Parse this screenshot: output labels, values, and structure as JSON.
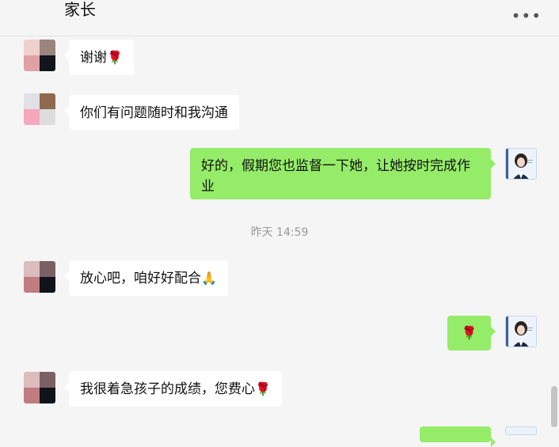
{
  "header": {
    "title": "家长",
    "more": "•••"
  },
  "messages": [
    {
      "text": "谢谢",
      "emoji": "🌹"
    },
    {
      "text": "你们有问题随时和我沟通"
    },
    {
      "text": "好的，假期您也监督一下她，让她按时完成作业"
    },
    {
      "timestamp": "昨天 14:59"
    },
    {
      "text": "放心吧，咱好好配合",
      "emoji": "🙏"
    },
    {
      "emoji": "🌹"
    },
    {
      "text": "我很着急孩子的成绩，您费心",
      "emoji": "🌹"
    }
  ],
  "colors": {
    "outgoing_bubble": "#95ec69",
    "incoming_bubble": "#ffffff",
    "background": "#f5f5f5"
  }
}
